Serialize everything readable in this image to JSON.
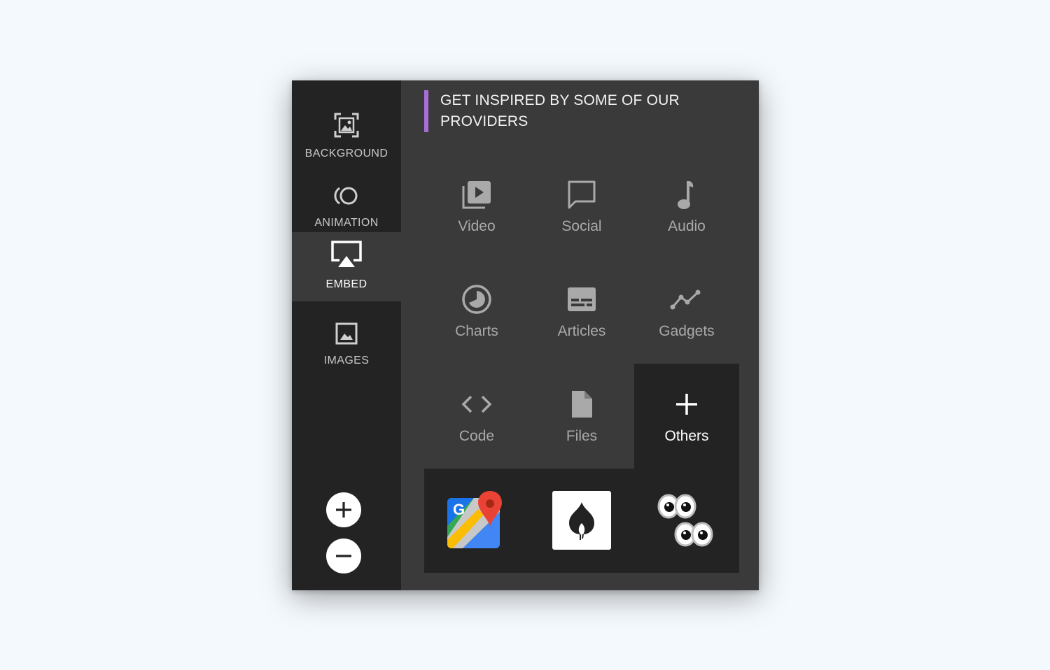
{
  "sidebar": {
    "items": [
      {
        "label": "BACKGROUND",
        "icon": "background-image-icon"
      },
      {
        "label": "ANIMATION",
        "icon": "animation-icon"
      },
      {
        "label": "EMBED",
        "icon": "embed-screen-icon",
        "active": true
      },
      {
        "label": "IMAGES",
        "icon": "image-icon"
      }
    ],
    "zoom": {
      "in_icon": "plus-icon",
      "out_icon": "minus-icon"
    }
  },
  "main": {
    "heading": "GET INSPIRED BY SOME OF OUR PROVIDERS",
    "accent_color": "#a86fd9",
    "categories": [
      {
        "label": "Video",
        "icon": "video-icon"
      },
      {
        "label": "Social",
        "icon": "chat-bubble-icon"
      },
      {
        "label": "Audio",
        "icon": "music-note-icon"
      },
      {
        "label": "Charts",
        "icon": "pie-chart-icon"
      },
      {
        "label": "Articles",
        "icon": "article-icon"
      },
      {
        "label": "Gadgets",
        "icon": "trend-line-icon"
      },
      {
        "label": "Code",
        "icon": "code-brackets-icon"
      },
      {
        "label": "Files",
        "icon": "file-icon"
      },
      {
        "label": "Others",
        "icon": "plus-icon",
        "active": true
      }
    ],
    "providers": [
      {
        "icon": "google-maps-icon"
      },
      {
        "icon": "flame-logo-icon"
      },
      {
        "icon": "googly-eyes-icon"
      }
    ]
  }
}
